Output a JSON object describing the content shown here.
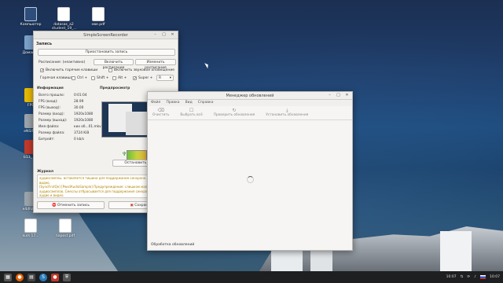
{
  "desktop": {
    "icons": [
      {
        "label": "Компьютер",
        "icon": "monitor-icon"
      },
      {
        "label": "datasas_a2 student_19_...",
        "icon": "document-icon"
      },
      {
        "label": "нве.pdf",
        "icon": "pdf-icon"
      },
      {
        "label": "Домаш...",
        "icon": "folder-icon"
      },
      {
        "label": "FPS",
        "icon": "app-icon"
      },
      {
        "label": "eNSIS...",
        "icon": "installer-icon"
      },
      {
        "label": "b13_ r...",
        "icon": "app-icon"
      },
      {
        "label": "e4dhas...",
        "icon": "app-icon"
      },
      {
        "label": "kurs 17...",
        "icon": "app-icon"
      },
      {
        "label": "tiapost.pdf",
        "icon": "pdf-icon"
      }
    ]
  },
  "ssr": {
    "title": "SimpleScreenRecorder",
    "section_record": "Запись",
    "pause_button": "Приостановить запись",
    "schedule_label": "Расписание: (неактивно)",
    "enable_schedule_button": "Включить расписание",
    "edit_schedule_button": "Изменить расписание",
    "enable_hotkey": "Включить горячие клавиши",
    "enable_sound": "Включить звуковое оповещение",
    "hotkey_label": "Горячая клавиша:",
    "ctrl": "Ctrl +",
    "shift": "Shift +",
    "alt": "Alt +",
    "super": "Super +",
    "key": "R",
    "section_info": "Информация",
    "section_preview": "Предпросмотр",
    "info": [
      {
        "k": "Всего прошло:",
        "v": "0:01:04"
      },
      {
        "k": "FPS (вход):",
        "v": "28.99"
      },
      {
        "k": "FPS (выход):",
        "v": "30.00"
      },
      {
        "k": "Размер (вход):",
        "v": "1920x1080"
      },
      {
        "k": "Размер (выход):",
        "v": "1920x1080"
      },
      {
        "k": "Имя файла:",
        "v": "ких об...01.mkv"
      },
      {
        "k": "Размер файла:",
        "v": "3724 KiB"
      },
      {
        "k": "Битрейт:",
        "v": "0 kb/s"
      }
    ],
    "start_preview_button": "Остановить предпр...",
    "section_journal": "Журнал",
    "log": [
      "аудиосэмплы. вставляется тишина для поддержания синхронн...",
      "видео.",
      "[SyncFirstQe] [PwsdAudioSample] Предупреждение: слишком мало",
      "аудиосэмплов. Смеслы отбрасывается для поддержания синхрон...",
      "аудио и видео."
    ],
    "cancel_button": "Отменить запись",
    "save_button": "Сохранить"
  },
  "upd": {
    "title": "Менеджер обновлений",
    "menu": [
      "Файл",
      "Правка",
      "Вид",
      "Справка"
    ],
    "tools": [
      {
        "icon": "clear-icon",
        "label": "Очистить"
      },
      {
        "icon": "select-all-icon",
        "label": "Выбрать всё"
      },
      {
        "icon": "refresh-icon",
        "label": "Проверить обновления"
      },
      {
        "icon": "install-icon",
        "label": "Установить обновления"
      }
    ],
    "status": "Обработка обновлений"
  },
  "taskbar": {
    "time": "10:07",
    "time2": "10:07"
  }
}
